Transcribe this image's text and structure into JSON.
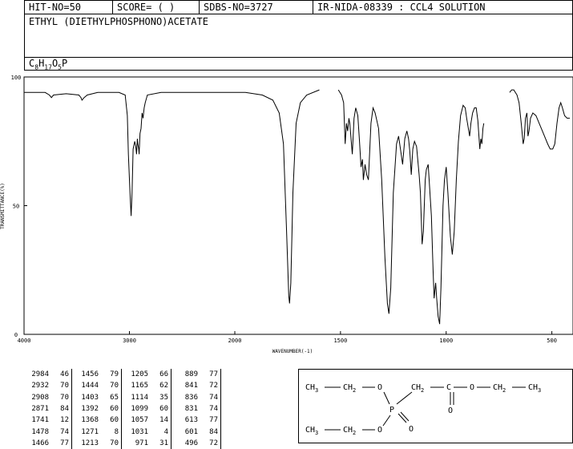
{
  "header": {
    "hit": "HIT-NO=50",
    "score": "SCORE=  (   )",
    "sdbs": "SDBS-NO=3727",
    "source": "IR-NIDA-08339 : CCL4 SOLUTION"
  },
  "compound_name": "ETHYL (DIETHYLPHOSPHONO)ACETATE",
  "formula": {
    "c": "C",
    "c_n": "8",
    "h": "H",
    "h_n": "17",
    "o": "O",
    "o_n": "5",
    "p": "P"
  },
  "chart_data": {
    "type": "line",
    "xlabel": "WAVENUMBER(-1)",
    "ylabel": "TRANSMITTANCE(%)",
    "xlim": [
      4000,
      400
    ],
    "ylim": [
      0,
      100
    ],
    "x_ticks": [
      "4000",
      "3000",
      "2000",
      "1500",
      "1000",
      "500"
    ],
    "y_ticks": [
      "100",
      "50",
      "0"
    ],
    "segments": [
      [
        [
          4000,
          94
        ],
        [
          3900,
          94
        ],
        [
          3800,
          94
        ],
        [
          3760,
          93
        ],
        [
          3740,
          92
        ],
        [
          3720,
          93
        ],
        [
          3600,
          93.5
        ],
        [
          3480,
          93
        ],
        [
          3460,
          92
        ],
        [
          3450,
          91
        ],
        [
          3430,
          92
        ],
        [
          3400,
          93
        ],
        [
          3300,
          94
        ],
        [
          3100,
          94
        ],
        [
          3040,
          93
        ],
        [
          3020,
          85
        ],
        [
          3010,
          70
        ],
        [
          2995,
          55
        ],
        [
          2984,
          46
        ],
        [
          2975,
          55
        ],
        [
          2965,
          72
        ],
        [
          2950,
          75
        ],
        [
          2940,
          73
        ],
        [
          2932,
          70
        ],
        [
          2925,
          76
        ],
        [
          2920,
          74
        ],
        [
          2912,
          72
        ],
        [
          2908,
          70
        ],
        [
          2900,
          78
        ],
        [
          2890,
          80
        ],
        [
          2880,
          86
        ],
        [
          2871,
          84
        ],
        [
          2860,
          88
        ],
        [
          2850,
          90
        ],
        [
          2830,
          93
        ],
        [
          2700,
          94
        ],
        [
          2500,
          94
        ],
        [
          2200,
          94
        ],
        [
          1950,
          94
        ],
        [
          1870,
          93
        ],
        [
          1820,
          91
        ],
        [
          1790,
          86
        ],
        [
          1770,
          74
        ],
        [
          1755,
          40
        ],
        [
          1745,
          15
        ],
        [
          1741,
          12
        ],
        [
          1735,
          20
        ],
        [
          1725,
          55
        ],
        [
          1710,
          82
        ],
        [
          1690,
          90
        ],
        [
          1660,
          93
        ],
        [
          1600,
          95
        ]
      ],
      [
        [
          1510,
          95
        ],
        [
          1495,
          93
        ],
        [
          1485,
          90
        ],
        [
          1478,
          74
        ],
        [
          1472,
          82
        ],
        [
          1466,
          79
        ],
        [
          1460,
          84
        ],
        [
          1456,
          82
        ],
        [
          1444,
          70
        ],
        [
          1436,
          84
        ],
        [
          1428,
          88
        ],
        [
          1418,
          85
        ],
        [
          1410,
          75
        ],
        [
          1403,
          65
        ],
        [
          1396,
          68
        ],
        [
          1392,
          60
        ],
        [
          1384,
          66
        ],
        [
          1376,
          62
        ],
        [
          1368,
          60
        ],
        [
          1356,
          82
        ],
        [
          1346,
          88
        ],
        [
          1336,
          86
        ],
        [
          1320,
          80
        ],
        [
          1305,
          60
        ],
        [
          1290,
          30
        ],
        [
          1278,
          12
        ],
        [
          1271,
          8
        ],
        [
          1262,
          18
        ],
        [
          1250,
          55
        ],
        [
          1235,
          74
        ],
        [
          1225,
          77
        ],
        [
          1213,
          70
        ],
        [
          1206,
          66
        ],
        [
          1196,
          76
        ],
        [
          1186,
          79
        ],
        [
          1178,
          76
        ],
        [
          1172,
          71
        ],
        [
          1165,
          62
        ],
        [
          1158,
          72
        ],
        [
          1150,
          75
        ],
        [
          1140,
          73
        ],
        [
          1128,
          62
        ],
        [
          1122,
          55
        ],
        [
          1114,
          35
        ],
        [
          1108,
          40
        ],
        [
          1099,
          60
        ],
        [
          1094,
          64
        ],
        [
          1085,
          66
        ],
        [
          1070,
          46
        ],
        [
          1062,
          25
        ],
        [
          1057,
          14
        ],
        [
          1050,
          20
        ],
        [
          1045,
          14
        ],
        [
          1038,
          7
        ],
        [
          1031,
          4
        ],
        [
          1025,
          18
        ],
        [
          1015,
          50
        ],
        [
          1008,
          60
        ],
        [
          1000,
          65
        ],
        [
          992,
          55
        ],
        [
          985,
          45
        ],
        [
          980,
          38
        ],
        [
          971,
          31
        ],
        [
          962,
          40
        ],
        [
          952,
          60
        ],
        [
          942,
          75
        ],
        [
          932,
          85
        ],
        [
          920,
          89
        ],
        [
          910,
          88
        ],
        [
          903,
          84
        ],
        [
          895,
          80
        ],
        [
          889,
          77
        ],
        [
          883,
          82
        ],
        [
          875,
          86
        ],
        [
          866,
          88
        ],
        [
          858,
          88
        ],
        [
          850,
          83
        ],
        [
          841,
          72
        ],
        [
          836,
          76
        ],
        [
          831,
          74
        ],
        [
          826,
          80
        ],
        [
          822,
          82
        ]
      ],
      [
        [
          700,
          94
        ],
        [
          690,
          95
        ],
        [
          680,
          95
        ],
        [
          665,
          93
        ],
        [
          655,
          90
        ],
        [
          645,
          82
        ],
        [
          636,
          74
        ],
        [
          631,
          76
        ],
        [
          625,
          84
        ],
        [
          618,
          86
        ],
        [
          613,
          77
        ],
        [
          608,
          79
        ],
        [
          601,
          84
        ],
        [
          590,
          86
        ],
        [
          575,
          85
        ],
        [
          560,
          82
        ],
        [
          540,
          78
        ],
        [
          520,
          74
        ],
        [
          508,
          72
        ],
        [
          496,
          72
        ],
        [
          486,
          74
        ],
        [
          476,
          82
        ],
        [
          466,
          88
        ],
        [
          458,
          90
        ],
        [
          450,
          88
        ],
        [
          440,
          85
        ],
        [
          428,
          84
        ],
        [
          415,
          84
        ]
      ]
    ],
    "peaks": [
      [
        "2984",
        "46",
        "1456",
        "79",
        "1205",
        "66",
        "889",
        "77"
      ],
      [
        "2932",
        "70",
        "1444",
        "70",
        "1165",
        "62",
        "841",
        "72"
      ],
      [
        "2908",
        "70",
        "1403",
        "65",
        "1114",
        "35",
        "836",
        "74"
      ],
      [
        "2871",
        "84",
        "1392",
        "60",
        "1099",
        "60",
        "831",
        "74"
      ],
      [
        "1741",
        "12",
        "1368",
        "60",
        "1057",
        "14",
        "613",
        "77"
      ],
      [
        "1478",
        "74",
        "1271",
        "8",
        "1031",
        "4",
        "601",
        "84"
      ],
      [
        "1466",
        "77",
        "1213",
        "70",
        "971",
        "31",
        "496",
        "72"
      ]
    ]
  },
  "structure": {
    "top_left": "CH",
    "sub3": "3",
    "ch2": "CH",
    "sub2": "2",
    "o": "O",
    "p": "P",
    "c": "C"
  }
}
